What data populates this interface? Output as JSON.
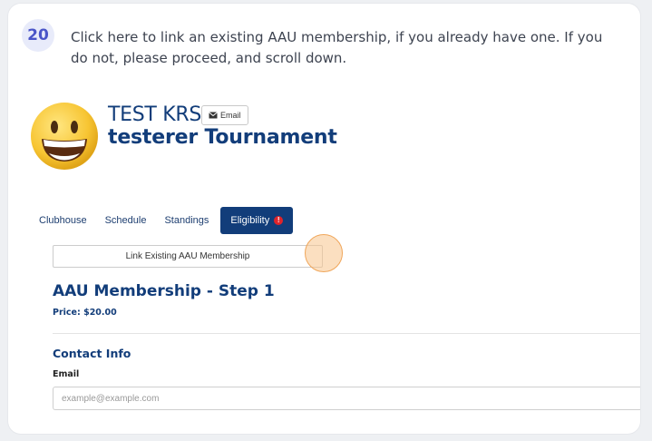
{
  "step": {
    "number": "20",
    "instruction": "Click here to link an existing AAU membership, if you already have one. If you do not, please proceed, and scroll down."
  },
  "profile": {
    "org_name": "TEST KRS",
    "email_button_label": "Email",
    "event_name": "testerer Tournament",
    "avatar_icon": "grinning-face-emoji"
  },
  "tabs": [
    {
      "label": "Clubhouse"
    },
    {
      "label": "Schedule"
    },
    {
      "label": "Standings"
    },
    {
      "label": "Eligibility",
      "active": true,
      "alert": "!"
    }
  ],
  "membership": {
    "link_button_label": "Link Existing AAU Membership",
    "title": "AAU Membership - Step 1",
    "price": "Price: $20.00"
  },
  "contact": {
    "section_title": "Contact Info",
    "email_label": "Email",
    "email_placeholder": "example@example.com",
    "email_value": ""
  },
  "colors": {
    "brand": "#123d7a",
    "alert": "#e0242b",
    "badge_bg": "#e8ebfa",
    "badge_text": "#4a55c8",
    "click_marker": "#f7c48c"
  }
}
